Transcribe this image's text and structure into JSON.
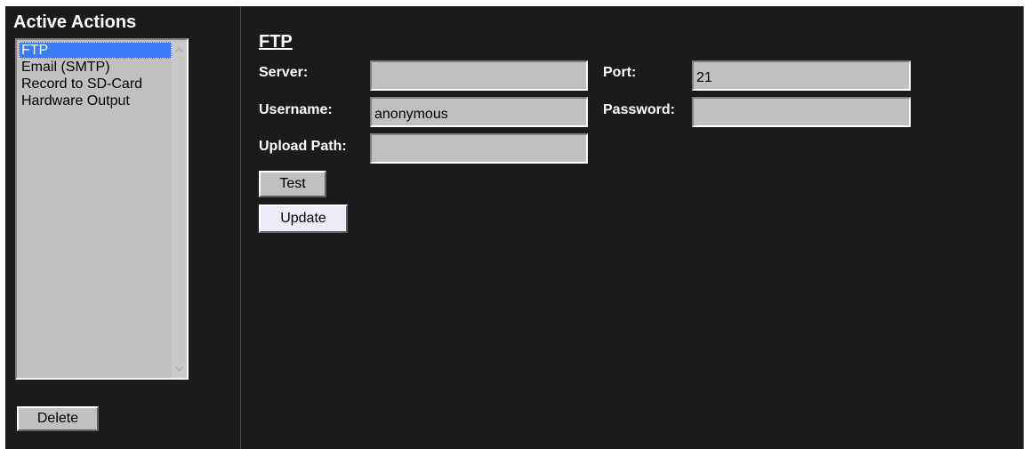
{
  "sidebar": {
    "title": "Active Actions",
    "items": [
      "FTP",
      "Email (SMTP)",
      "Record to SD-Card",
      "Hardware Output"
    ],
    "selected_index": 0,
    "delete_label": "Delete"
  },
  "form": {
    "title": "FTP",
    "server_label": "Server:",
    "server_value": "",
    "port_label": "Port:",
    "port_value": "21",
    "username_label": "Username:",
    "username_value": "anonymous",
    "password_label": "Password:",
    "password_value": "",
    "upload_path_label": "Upload Path:",
    "upload_path_value": "",
    "test_label": "Test",
    "update_label": "Update"
  },
  "colors": {
    "background": "#1b1b1b",
    "selection": "#3b7df7",
    "control": "#c0c0c0"
  }
}
